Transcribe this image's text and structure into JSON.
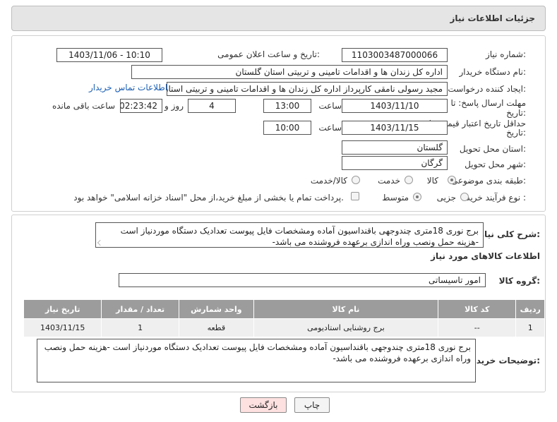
{
  "header": {
    "title": "جزئیات اطلاعات نیاز"
  },
  "form": {
    "need_number_label": "شماره نیاز:",
    "need_number": "1103003487000066",
    "announce_label": "تاریخ و ساعت اعلان عمومی:",
    "announce_value": "1403/11/06 - 10:10",
    "buyer_org_label": "نام دستگاه خریدار:",
    "buyer_org": "اداره کل زندان ها و اقدامات تامینی و تربیتی استان گلستان",
    "requester_label": "ایجاد کننده درخواست:",
    "requester": "مجید رسولی نامقی کارپرداز اداره کل زندان ها و اقدامات تامینی و تربیتی استان",
    "contact_link": "اطلاعات تماس خریدار",
    "deadline_label": "مهلت ارسال پاسخ: تا",
    "deadline_label2": "تاریخ:",
    "deadline_date": "1403/11/10",
    "hour_label": "ساعت",
    "deadline_time": "13:00",
    "days_value": "4",
    "days_label": "روز و",
    "remaining_value": "02:23:42",
    "remaining_label": "ساعت باقی مانده",
    "validity_label": "حداقل تاریخ اعتبار قیمت: تا",
    "validity_label2": "تاریخ:",
    "validity_date": "1403/11/15",
    "validity_hour_label": "ساعت",
    "validity_time": "10:00",
    "province_label": "استان محل تحویل:",
    "province": "گلستان",
    "city_label": "شهر محل تحویل:",
    "city": "گرگان",
    "category_label": "طبقه بندی موضوعی:",
    "category_options": [
      "کالا",
      "خدمت",
      "کالا/خدمت"
    ],
    "process_label": "نوع فرآیند خرید :",
    "process_options": [
      "جزیی",
      "متوسط"
    ],
    "payment_note": "پرداخت تمام یا بخشی از مبلغ خرید،از محل \"اسناد خزانه اسلامی\" خواهد بود."
  },
  "description": {
    "label": "شرح کلی نیاز:",
    "text": "برج نوری 18متری چندوجهی باقنداسیون آماده ومشخصات فایل پیوست تعدادیک دستگاه موردنیاز است -هزینه حمل ونصب وراه اندازی برعهده فروشنده می باشد-"
  },
  "goods": {
    "section_title": "اطلاعات کالاهای مورد نیاز",
    "group_label": "گروه کالا:",
    "group_value": "امور تاسیساتی",
    "columns": [
      "ردیف",
      "کد کالا",
      "نام کالا",
      "واحد شمارش",
      "تعداد / مقدار",
      "تاریخ نیاز"
    ],
    "rows": [
      {
        "row": "1",
        "code": "--",
        "name": "برج روشنایی استادیومی",
        "unit": "قطعه",
        "qty": "1",
        "date": "1403/11/15"
      }
    ]
  },
  "buyer_notes": {
    "label": "توضیحات خریدار:",
    "text": "برج نوری 18متری چندوجهی باقنداسیون آماده ومشخصات فایل پیوست تعدادیک دستگاه موردنیاز است -هزینه حمل ونصب وراه اندازی برعهده فروشنده می باشد-"
  },
  "buttons": {
    "print": "چاپ",
    "back": "بازگشت"
  },
  "colors": {
    "header_bg": "#e5e5e5",
    "table_header": "#9c9c9c",
    "back_button": "#fde0e0",
    "link": "#1a5fb4"
  }
}
